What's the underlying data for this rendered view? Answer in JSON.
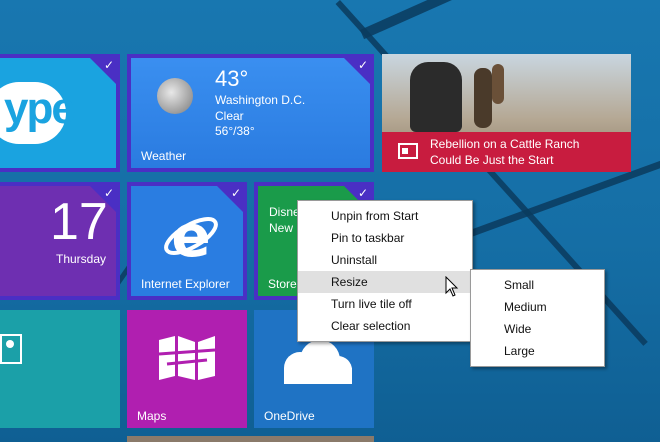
{
  "weather": {
    "temp": "43°",
    "city": "Washington D.C.",
    "condition": "Clear",
    "range": "56°/38°",
    "label": "Weather"
  },
  "calendar": {
    "day": "17",
    "weekday": "Thursday"
  },
  "tiles": {
    "skype_label": "ype",
    "ie_label": "Internet Explorer",
    "store_label": "Store",
    "store_text": "Disne\nNew",
    "maps_label": "Maps",
    "onedrive_label": "OneDrive"
  },
  "news": {
    "headline": "Rebellion on a Cattle Ranch\nCould Be Just the Start"
  },
  "context_menu": {
    "items": [
      "Unpin from Start",
      "Pin to taskbar",
      "Uninstall",
      "Resize",
      "Turn live tile off",
      "Clear selection"
    ]
  },
  "resize_menu": {
    "items": [
      "Small",
      "Medium",
      "Wide",
      "Large"
    ]
  },
  "colors": {
    "skype": "#1aa3e0",
    "weather": "#2d83e8",
    "calendar": "#6e2fb1",
    "ie": "#2a7de1",
    "store": "#1a9b4a",
    "teal": "#1ba0a8",
    "maps": "#b01fb0",
    "onedrive": "#1f73c4",
    "news": "#c81c3f",
    "selection": "#4a2fc4"
  }
}
